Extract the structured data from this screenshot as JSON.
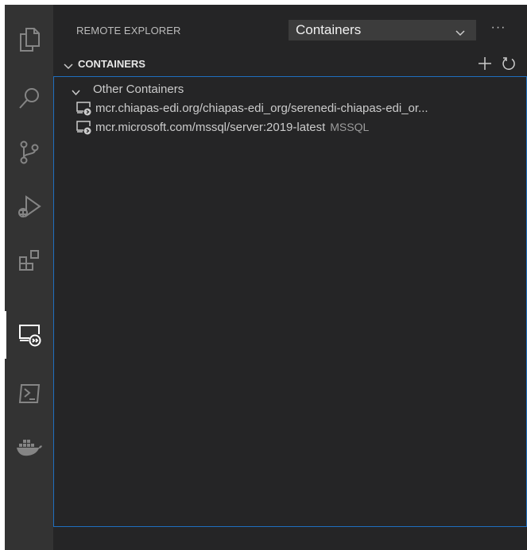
{
  "activity_bar": {
    "items": [
      {
        "icon": "explorer-icon"
      },
      {
        "icon": "search-icon"
      },
      {
        "icon": "source-control-icon"
      },
      {
        "icon": "run-debug-icon"
      },
      {
        "icon": "extensions-icon"
      },
      {
        "icon": "remote-explorer-icon",
        "active": true
      },
      {
        "icon": "terminal-icon"
      },
      {
        "icon": "docker-icon"
      }
    ]
  },
  "sidebar": {
    "title": "REMOTE EXPLORER",
    "view_select": {
      "value": "Containers"
    },
    "more_actions": "···",
    "section": {
      "title": "CONTAINERS",
      "group": "Other Containers",
      "items": [
        {
          "label": "mcr.chiapas-edi.org/chiapas-edi_org/serenedi-chiapas-edi_or...",
          "description": ""
        },
        {
          "label": "mcr.microsoft.com/mssql/server:2019-latest",
          "description": "MSSQL"
        }
      ]
    }
  },
  "colors": {
    "activity_bar_bg": "#333333",
    "sidebar_bg": "#252526",
    "focus_border": "#1f6fbf",
    "text": "#cccccc",
    "description": "#9d9d9d"
  }
}
